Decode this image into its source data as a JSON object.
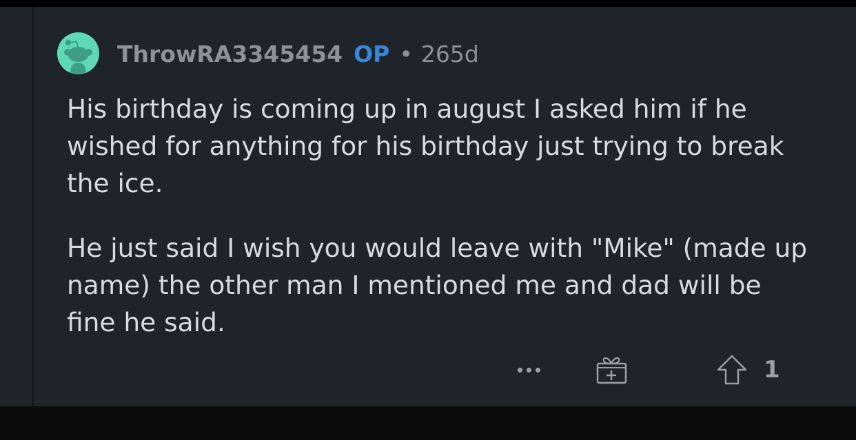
{
  "comment": {
    "username": "ThrowRA3345454",
    "op_badge": "OP",
    "separator": "•",
    "age": "265d",
    "paragraphs": [
      "His birthday is coming up in august I asked him if he wished for anything for his birthday just trying to break the ice.",
      "He just said I wish you would leave with \"Mike\" (made up name) the other man I mentioned me and dad will be fine he said."
    ],
    "avatar_icon": "snoo-avatar-icon",
    "colors": {
      "background": "#1f232a",
      "username": "#8d9298",
      "op_badge": "#3a86d6",
      "body_text": "#d9dcdf",
      "avatar": "#5fd8b5"
    }
  },
  "actions": {
    "more_icon": "more-options-icon",
    "award_icon": "gift-award-icon",
    "upvote_icon": "upvote-arrow-icon",
    "vote_count": "1"
  }
}
